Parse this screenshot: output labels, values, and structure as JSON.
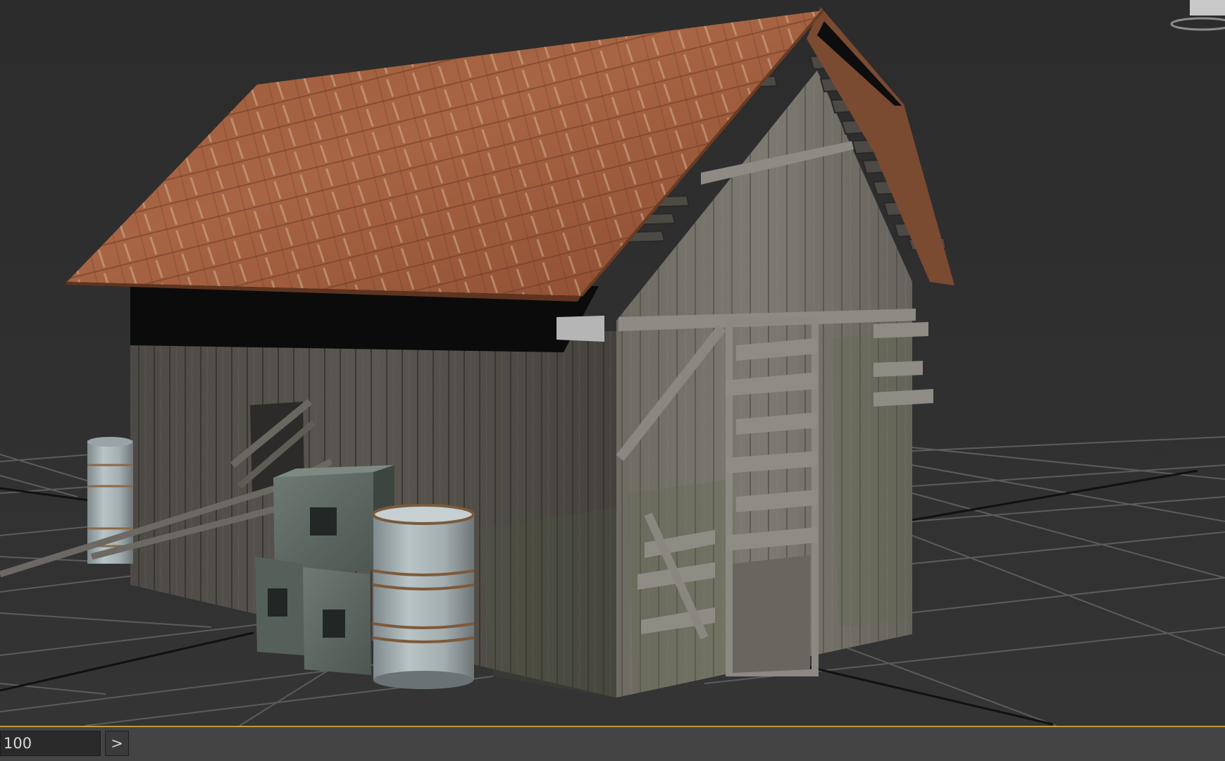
{
  "viewport": {
    "background_color": "#2d2d2d",
    "grid_color": "#5a5a5a",
    "axis_color": "#0f0f0f"
  },
  "timebar": {
    "frame_value": "100",
    "next_label": ">",
    "accent_color": "#c39a3d"
  },
  "icons": {
    "viewcube": "viewcube-icon"
  }
}
